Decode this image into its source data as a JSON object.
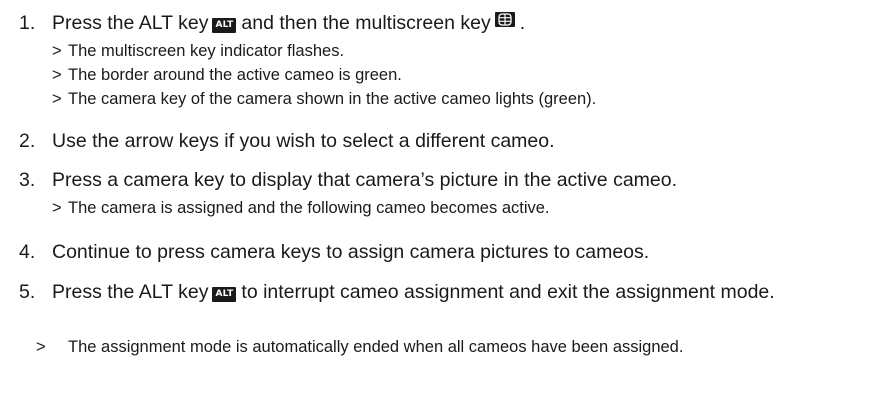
{
  "steps": [
    {
      "number": "1.",
      "text_before": "Press the ALT key",
      "key1": "ALT",
      "text_middle": "and then the multiscreen key",
      "key2_icon": "multiscreen-grid-icon",
      "text_after": ".",
      "results": [
        "The multiscreen key indicator flashes.",
        "The border around the active cameo is green.",
        "The camera key of the camera shown in the active cameo lights (green)."
      ]
    },
    {
      "number": "2.",
      "text": "Use the arrow keys if you wish to select a different cameo."
    },
    {
      "number": "3.",
      "text": "Press a camera key to display that camera’s picture in the active cameo.",
      "results": [
        "The camera is assigned and the following cameo becomes active."
      ]
    },
    {
      "number": "4.",
      "text": "Continue to press camera keys to assign camera pictures to cameos."
    },
    {
      "number": "5.",
      "text_before": "Press the ALT key",
      "key1": "ALT",
      "text_after": "to interrupt cameo assignment and exit the assignment mode.",
      "results": [
        "The assignment mode is automatically ended when all cameos have been assigned."
      ]
    }
  ],
  "result_marker": ">"
}
